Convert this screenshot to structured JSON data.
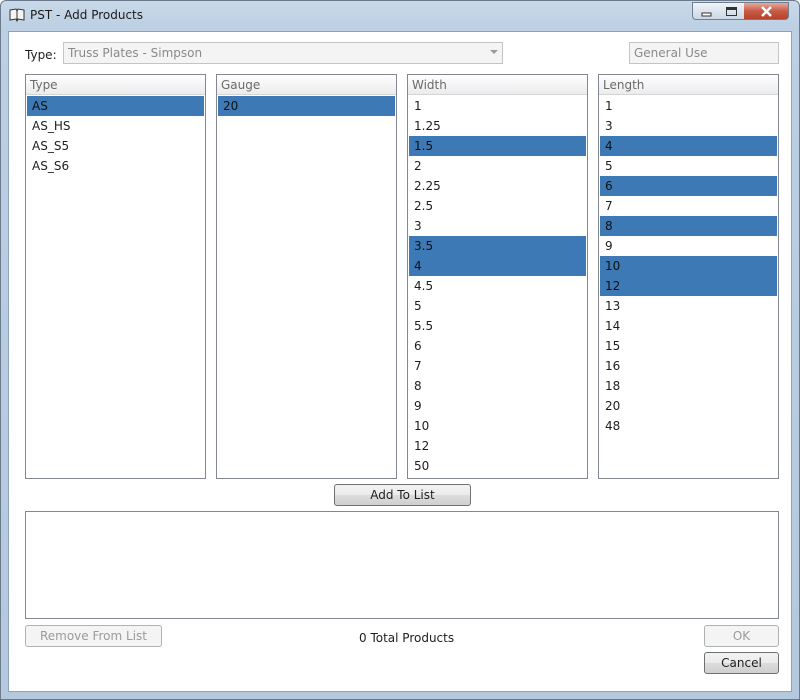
{
  "window": {
    "title": "PST - Add Products"
  },
  "form": {
    "type_label": "Type:",
    "type_value": "Truss Plates - Simpson",
    "usage_value": "General Use"
  },
  "lists": [
    {
      "header": "Type",
      "items": [
        {
          "label": "AS",
          "selected": true
        },
        {
          "label": "AS_HS",
          "selected": false
        },
        {
          "label": "AS_S5",
          "selected": false
        },
        {
          "label": "AS_S6",
          "selected": false
        }
      ]
    },
    {
      "header": "Gauge",
      "items": [
        {
          "label": "20",
          "selected": true
        }
      ]
    },
    {
      "header": "Width",
      "items": [
        {
          "label": "1",
          "selected": false
        },
        {
          "label": "1.25",
          "selected": false
        },
        {
          "label": "1.5",
          "selected": true
        },
        {
          "label": "2",
          "selected": false
        },
        {
          "label": "2.25",
          "selected": false
        },
        {
          "label": "2.5",
          "selected": false
        },
        {
          "label": "3",
          "selected": false
        },
        {
          "label": "3.5",
          "selected": true
        },
        {
          "label": "4",
          "selected": true
        },
        {
          "label": "4.5",
          "selected": false
        },
        {
          "label": "5",
          "selected": false
        },
        {
          "label": "5.5",
          "selected": false
        },
        {
          "label": "6",
          "selected": false
        },
        {
          "label": "7",
          "selected": false
        },
        {
          "label": "8",
          "selected": false
        },
        {
          "label": "9",
          "selected": false
        },
        {
          "label": "10",
          "selected": false
        },
        {
          "label": "12",
          "selected": false
        },
        {
          "label": "50",
          "selected": false
        }
      ]
    },
    {
      "header": "Length",
      "items": [
        {
          "label": "1",
          "selected": false
        },
        {
          "label": "3",
          "selected": false
        },
        {
          "label": "4",
          "selected": true
        },
        {
          "label": "5",
          "selected": false
        },
        {
          "label": "6",
          "selected": true
        },
        {
          "label": "7",
          "selected": false
        },
        {
          "label": "8",
          "selected": true
        },
        {
          "label": "9",
          "selected": false
        },
        {
          "label": "10",
          "selected": true
        },
        {
          "label": "12",
          "selected": true
        },
        {
          "label": "13",
          "selected": false
        },
        {
          "label": "14",
          "selected": false
        },
        {
          "label": "15",
          "selected": false
        },
        {
          "label": "16",
          "selected": false
        },
        {
          "label": "18",
          "selected": false
        },
        {
          "label": "20",
          "selected": false
        },
        {
          "label": "48",
          "selected": false
        }
      ]
    }
  ],
  "buttons": {
    "add_to_list": "Add To List",
    "remove_from_list": "Remove From List",
    "ok": "OK",
    "cancel": "Cancel"
  },
  "status": {
    "total_products": "0 Total Products"
  },
  "colors": {
    "selection": "#3d7ab5",
    "frame": "#b9cde2"
  }
}
